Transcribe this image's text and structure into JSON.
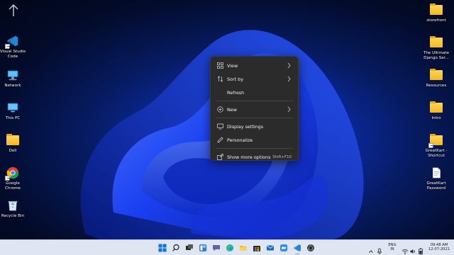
{
  "desktop": {
    "left_icons": [
      {
        "label": "Visual Studio Code",
        "icon": "vscode-icon"
      },
      {
        "label": "Network",
        "icon": "network-icon"
      },
      {
        "label": "This PC",
        "icon": "this-pc-icon"
      },
      {
        "label": "Dell",
        "icon": "folder-icon"
      },
      {
        "label": "Google Chrome",
        "icon": "chrome-icon"
      },
      {
        "label": "Recycle Bin",
        "icon": "recycle-bin-icon"
      }
    ],
    "right_icons": [
      {
        "label": "storefront",
        "icon": "folder-icon"
      },
      {
        "label": "The Ultimate Django Ser...",
        "icon": "folder-icon"
      },
      {
        "label": "Resources",
        "icon": "folder-icon"
      },
      {
        "label": "Intro",
        "icon": "folder-icon"
      },
      {
        "label": "GreatKart - Shortcut",
        "icon": "folder-shortcut-icon"
      },
      {
        "label": "GreatKart Password",
        "icon": "text-file-icon"
      }
    ]
  },
  "context_menu": {
    "items": [
      {
        "label": "View",
        "icon": "grid-view-icon",
        "submenu": true
      },
      {
        "label": "Sort by",
        "icon": "sort-icon",
        "submenu": true
      },
      {
        "label": "Refresh",
        "icon": "",
        "submenu": false
      },
      {
        "label": "New",
        "icon": "plus-circle-icon",
        "submenu": true
      },
      {
        "label": "Display settings",
        "icon": "display-icon",
        "submenu": false
      },
      {
        "label": "Personalize",
        "icon": "pen-icon",
        "submenu": false
      },
      {
        "label": "Show more options",
        "icon": "share-icon",
        "submenu": false,
        "accelerator": "Shift+F10"
      }
    ]
  },
  "taskbar": {
    "apps": [
      "start-icon",
      "search-icon",
      "task-view-icon",
      "widgets-icon",
      "chat-icon",
      "edge-icon",
      "file-explorer-icon",
      "store-icon",
      "mail-icon",
      "zoom-icon",
      "vscode-icon",
      "chrome-icon"
    ],
    "tray": {
      "language_line1": "ENG",
      "language_line2": "IN",
      "time": "09:48 AM",
      "date": "12-07-2021"
    }
  }
}
